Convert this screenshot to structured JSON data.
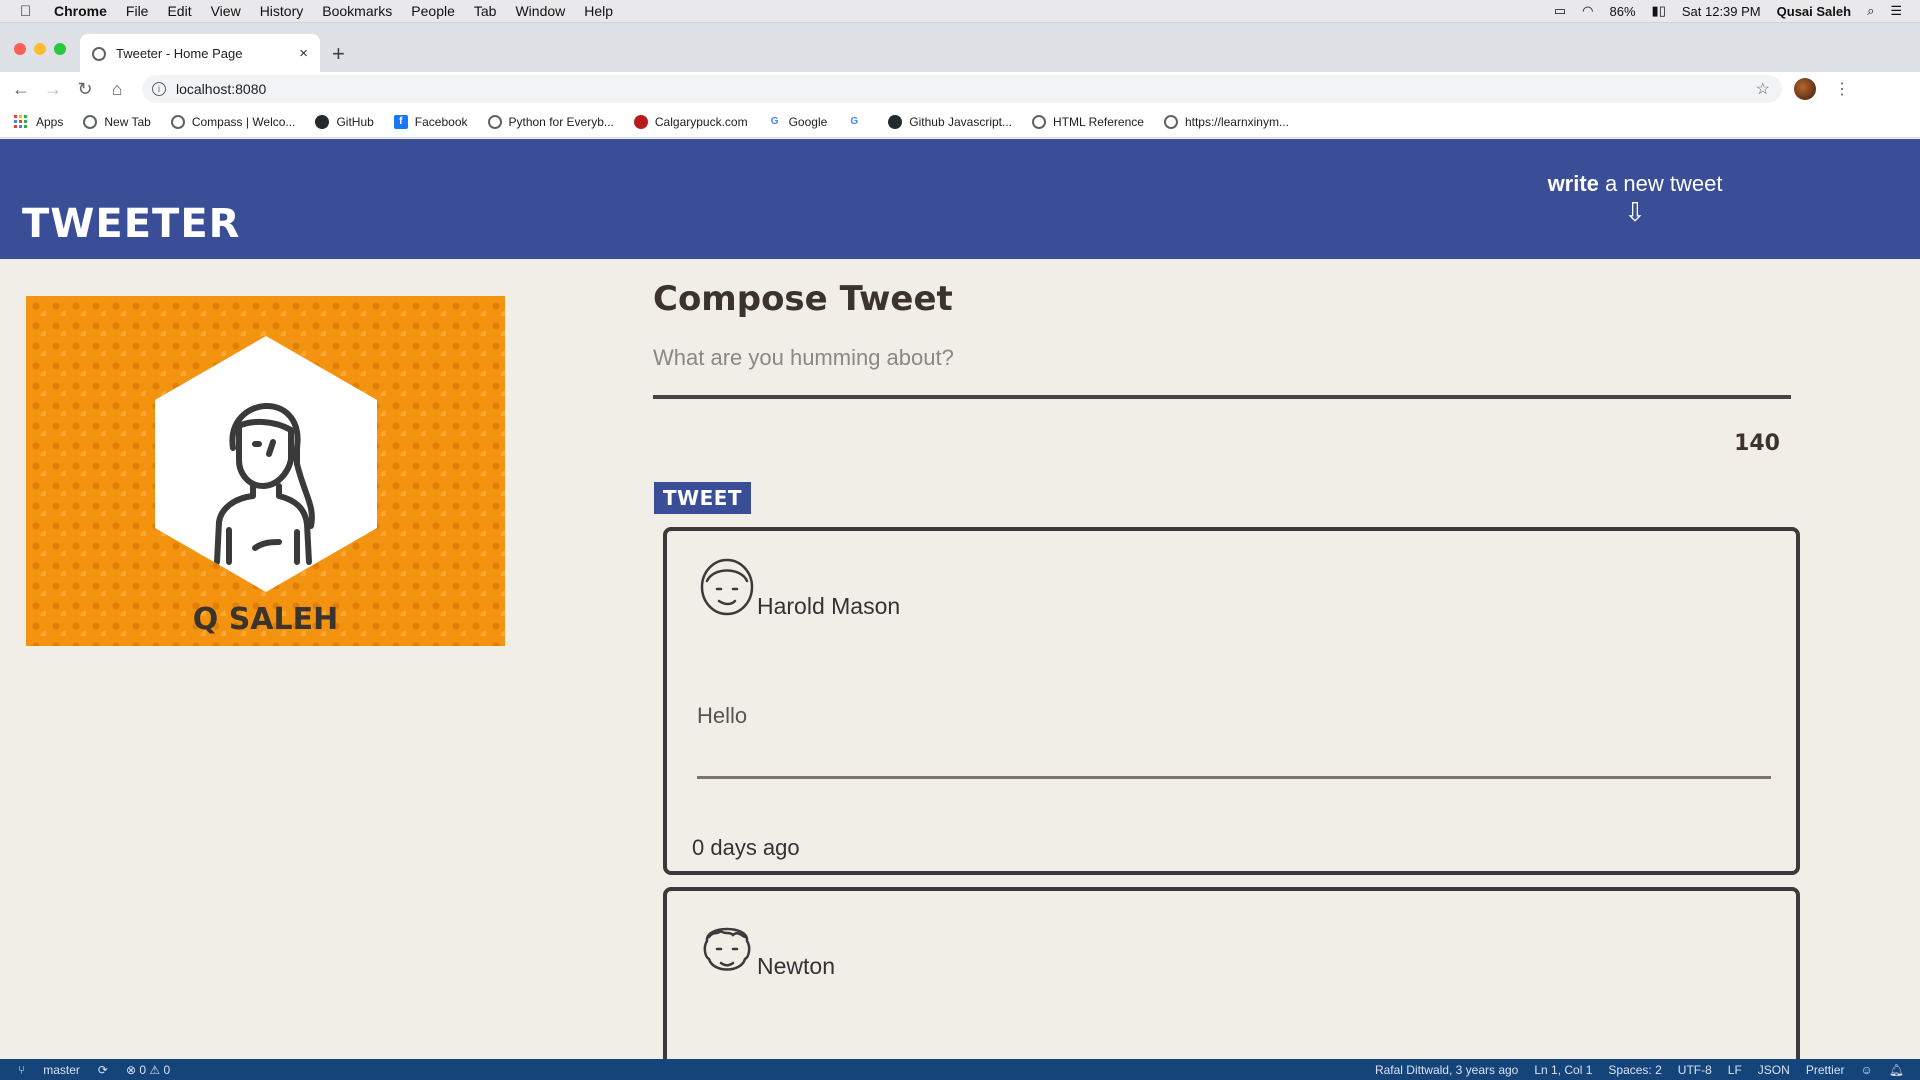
{
  "menubar": {
    "apple_icon": "apple-icon",
    "app_name": "Chrome",
    "items": [
      "File",
      "Edit",
      "View",
      "History",
      "Bookmarks",
      "People",
      "Tab",
      "Window",
      "Help"
    ],
    "battery": "86%",
    "clock": "Sat 12:39 PM",
    "user": "Qusai Saleh"
  },
  "browser": {
    "tab_title": "Tweeter - Home Page",
    "tab_close": "×",
    "new_tab": "+",
    "url": "localhost:8080",
    "bookmarks": [
      "Apps",
      "New Tab",
      "Compass | Welco...",
      "GitHub",
      "Facebook",
      "Python for Everyb...",
      "Calgarypuck.com",
      "Google",
      "",
      "Github Javascript...",
      "HTML Reference",
      "https://learnxinym..."
    ]
  },
  "header": {
    "logo": "TWEETER",
    "write_bold": "write",
    "write_rest": " a new tweet",
    "arrow": "⇩"
  },
  "profile": {
    "name": "Q SALEH"
  },
  "compose": {
    "title": "Compose Tweet",
    "placeholder": "What are you humming about?",
    "value": "",
    "counter": "140",
    "button": "TWEET"
  },
  "tweets": [
    {
      "author": "Harold Mason",
      "content": "Hello",
      "timestamp": "0 days ago"
    },
    {
      "author": "Newton"
    }
  ],
  "statusbar": {
    "branch": "master",
    "errors": "0",
    "warnings": "0",
    "blame": "Rafal Dittwald, 3 years ago",
    "position": "Ln 1, Col 1",
    "spaces": "Spaces: 2",
    "encoding": "UTF-8",
    "eol": "LF",
    "language": "JSON",
    "formatter": "Prettier"
  },
  "colors": {
    "header_bg": "#394e96",
    "page_bg": "#f1eee8",
    "profile_bg": "#f3930f",
    "statusbar_bg": "#15447a"
  }
}
